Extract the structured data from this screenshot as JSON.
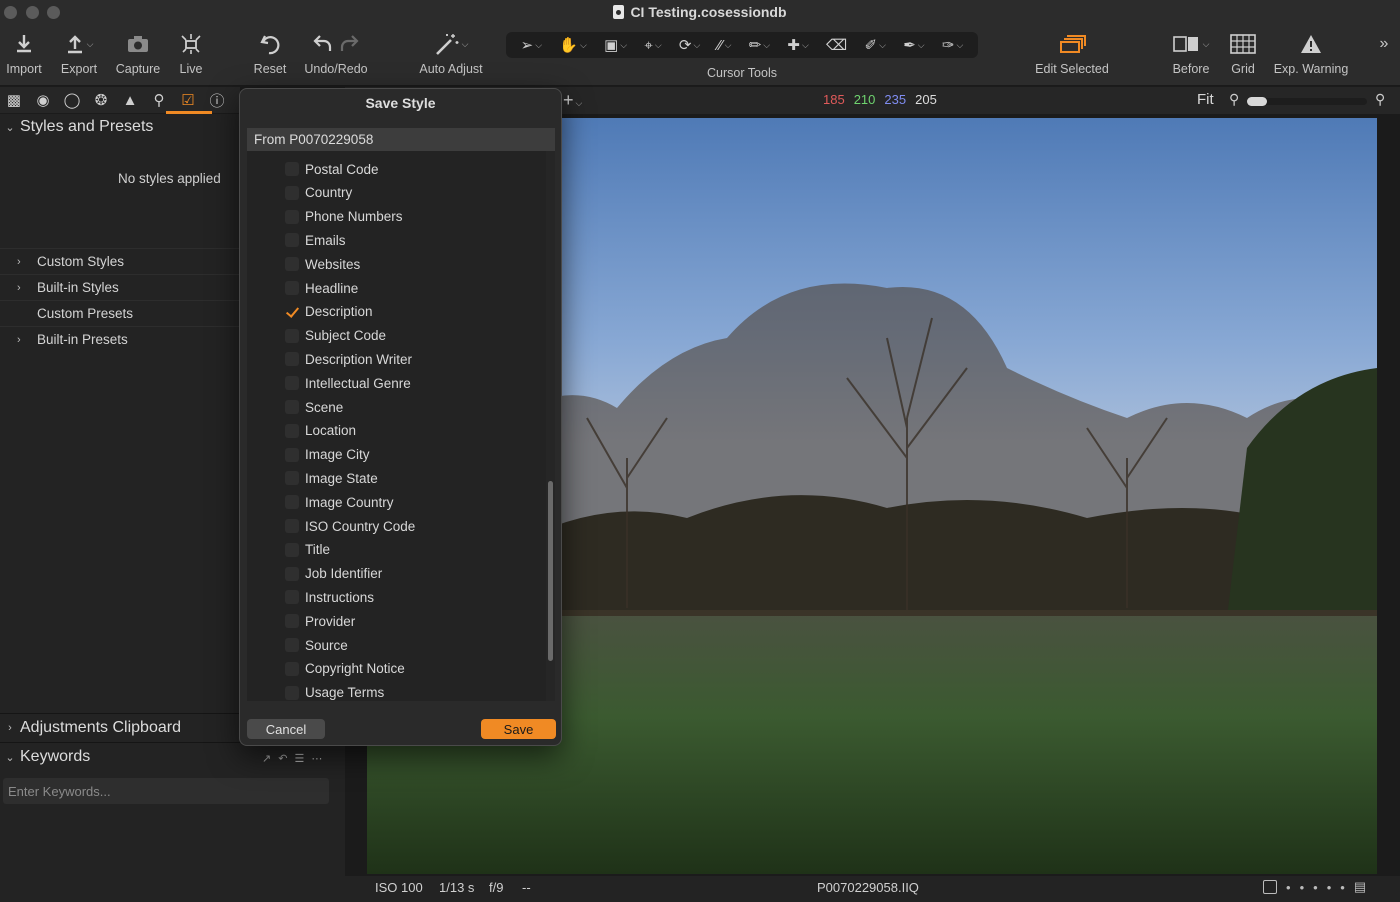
{
  "window": {
    "title": "CI Testing.cosessiondb"
  },
  "toolbar": {
    "import": "Import",
    "export": "Export",
    "capture": "Capture",
    "live": "Live",
    "reset": "Reset",
    "undo_redo": "Undo/Redo",
    "auto_adjust": "Auto Adjust",
    "cursor_tools": "Cursor Tools",
    "edit_selected": "Edit Selected",
    "before": "Before",
    "grid": "Grid",
    "exp_warning": "Exp. Warning"
  },
  "left_panel": {
    "styles_section": "Styles and Presets",
    "no_styles": "No styles applied",
    "items": [
      {
        "label": "Custom Styles",
        "expandable": true
      },
      {
        "label": "Built-in Styles",
        "expandable": true
      },
      {
        "label": "Custom Presets",
        "expandable": false
      },
      {
        "label": "Built-in Presets",
        "expandable": true
      }
    ],
    "adjustments_clipboard": "Adjustments Clipboard",
    "keywords": "Keywords",
    "keywords_placeholder": "Enter Keywords..."
  },
  "viewer": {
    "readout": {
      "r": "185",
      "g": "210",
      "b": "235",
      "l": "205"
    },
    "zoom_label": "Fit",
    "zoom_level": 0.0,
    "status": {
      "iso": "ISO 100",
      "shutter": "1/13 s",
      "aperture": "f/9",
      "extra": "--",
      "filename": "P0070229058.IIQ"
    }
  },
  "dialog": {
    "title": "Save Style",
    "header": "From P0070229058",
    "items": [
      {
        "label": "Postal Code",
        "checked": false
      },
      {
        "label": "Country",
        "checked": false
      },
      {
        "label": "Phone Numbers",
        "checked": false
      },
      {
        "label": "Emails",
        "checked": false
      },
      {
        "label": "Websites",
        "checked": false
      },
      {
        "label": "Headline",
        "checked": false
      },
      {
        "label": "Description",
        "checked": true
      },
      {
        "label": "Subject Code",
        "checked": false
      },
      {
        "label": "Description Writer",
        "checked": false
      },
      {
        "label": "Intellectual Genre",
        "checked": false
      },
      {
        "label": "Scene",
        "checked": false
      },
      {
        "label": "Location",
        "checked": false
      },
      {
        "label": "Image City",
        "checked": false
      },
      {
        "label": "Image State",
        "checked": false
      },
      {
        "label": "Image Country",
        "checked": false
      },
      {
        "label": "ISO Country Code",
        "checked": false
      },
      {
        "label": "Title",
        "checked": false
      },
      {
        "label": "Job Identifier",
        "checked": false
      },
      {
        "label": "Instructions",
        "checked": false
      },
      {
        "label": "Provider",
        "checked": false
      },
      {
        "label": "Source",
        "checked": false
      },
      {
        "label": "Copyright Notice",
        "checked": false
      },
      {
        "label": "Usage Terms",
        "checked": false
      }
    ],
    "cancel": "Cancel",
    "save": "Save"
  },
  "colors": {
    "accent": "#f08a24",
    "readout_r": "#e05a5a",
    "readout_g": "#6fd36f",
    "readout_b": "#7f8cf0",
    "readout_l": "#dddddd"
  }
}
